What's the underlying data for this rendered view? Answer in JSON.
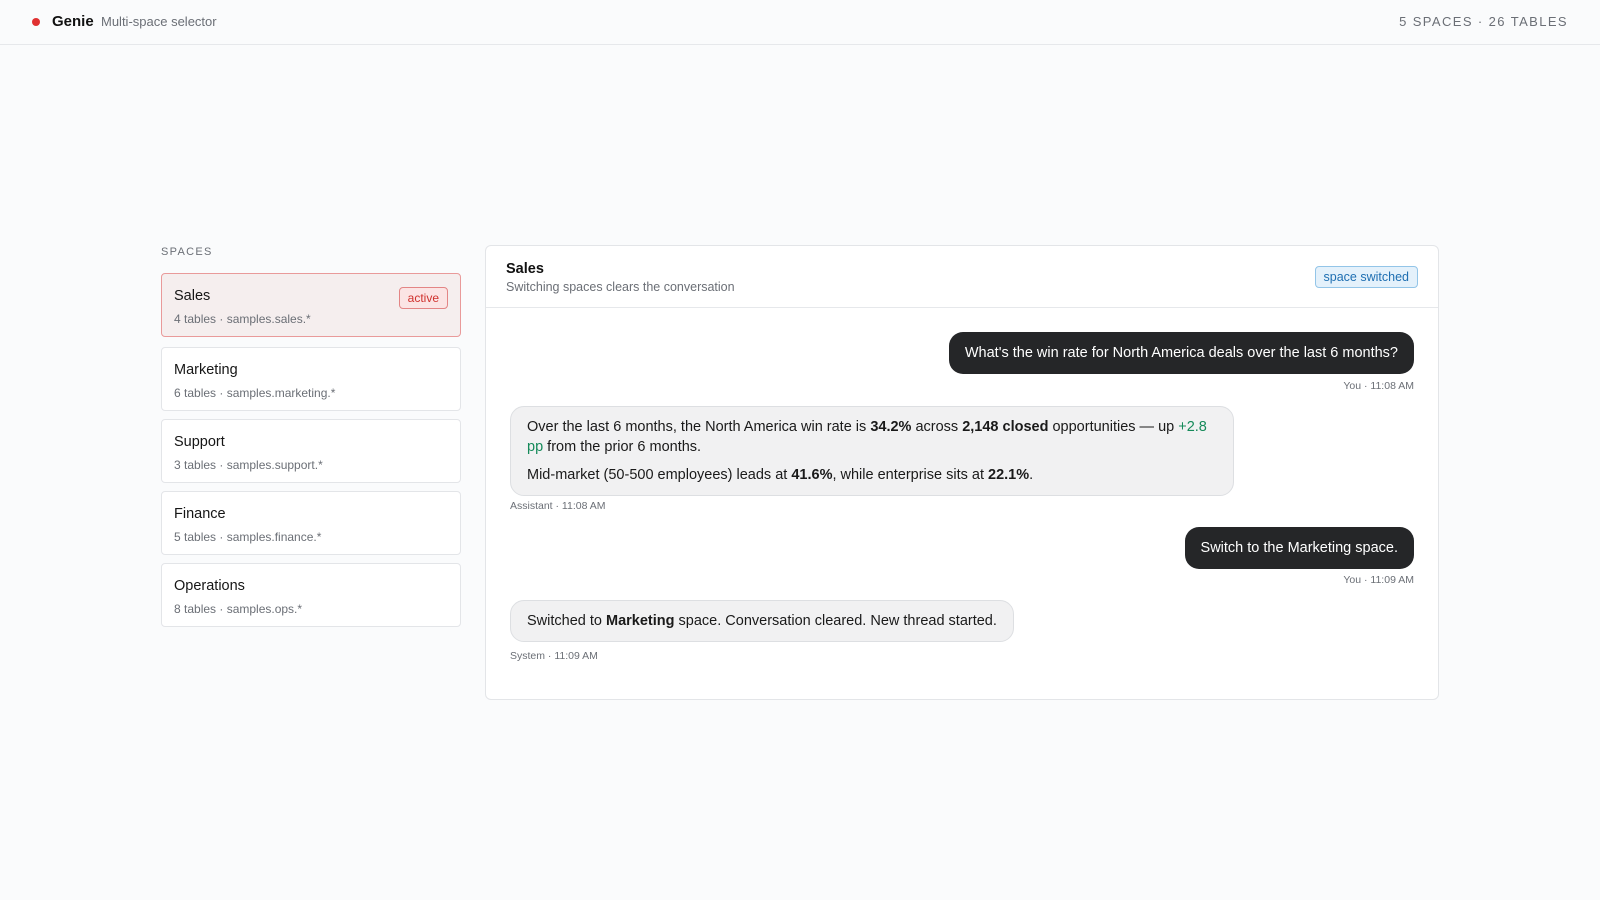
{
  "header": {
    "app_name": "Genie",
    "subtitle": "Multi-space selector",
    "stats": "5 SPACES · 26 TABLES",
    "brand_color": "#e03131"
  },
  "sidebar": {
    "heading": "SPACES",
    "items": [
      {
        "name": "Sales",
        "meta": "4 tables · samples.sales.*",
        "badge": "active"
      },
      {
        "name": "Marketing",
        "meta": "6 tables · samples.marketing.*"
      },
      {
        "name": "Support",
        "meta": "3 tables · samples.support.*"
      },
      {
        "name": "Finance",
        "meta": "5 tables · samples.finance.*"
      },
      {
        "name": "Operations",
        "meta": "8 tables · samples.ops.*"
      }
    ]
  },
  "panel": {
    "title": "Sales",
    "subtitle": "Switching spaces clears the conversation",
    "badge": "space switched"
  },
  "messages": [
    {
      "role": "user",
      "text": "What's the win rate for North America deals over the last 6 months?",
      "meta": "You · 11:08 AM"
    },
    {
      "role": "assistant",
      "p1_a": "Over the last 6 months, the North America win rate is ",
      "p1_b": "34.2%",
      "p1_c": " across ",
      "p1_d": "2,148 closed",
      "p1_e": " opportunities — up ",
      "p1_f": "+2.8 pp",
      "p1_g": " from the prior 6 months.",
      "p2_a": "Mid-market (50-500 employees) leads at ",
      "p2_b": "41.6%",
      "p2_c": ", while enterprise sits at ",
      "p2_d": "22.1%",
      "p2_e": ".",
      "meta": "Assistant · 11:08 AM"
    },
    {
      "role": "user",
      "text": "Switch to the Marketing space.",
      "meta": "You · 11:09 AM"
    },
    {
      "role": "system",
      "a": "Switched to ",
      "b": "Marketing",
      "c": " space. Conversation cleared. New thread started.",
      "meta": "System · 11:09 AM"
    }
  ]
}
